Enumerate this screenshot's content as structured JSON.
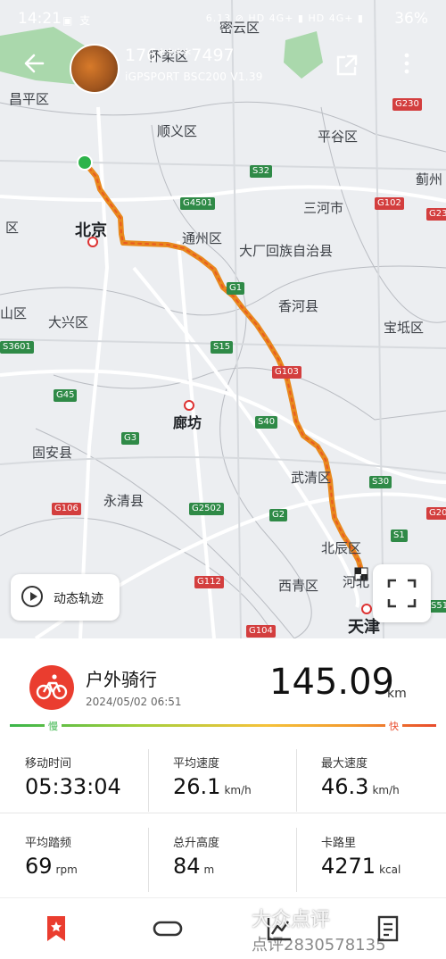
{
  "status_bar": {
    "time": "14:21",
    "icons_left": "▣ 支",
    "signal": "6.13 ⊘ HD 4G+ ▮ HD 4G+ ▮",
    "battery": "36%"
  },
  "header": {
    "device_title": "176****7497",
    "device_subtitle": "iGPSPORT BSC200 V1.39"
  },
  "map": {
    "places": {
      "miyun": "密云区",
      "huairou": "怀柔区",
      "changping": "昌平区",
      "shunyi": "顺义区",
      "pinggu": "平谷区",
      "jizhou": "蓟州",
      "beijing": "北京",
      "tongzhou": "通州区",
      "sanhe": "三河市",
      "dachang": "大厂回族自治县",
      "xianghe": "香河县",
      "baodi": "宝坻区",
      "daxing": "大兴区",
      "langfang": "廊坊",
      "guan": "固安县",
      "wuqing": "武清区",
      "yongqing": "永清县",
      "beichen": "北辰区",
      "xiqing": "西青区",
      "hexi": "河北",
      "tianjin": "天津",
      "edge_qu1": "区",
      "edge_shan": "山区"
    },
    "roads": [
      "G230",
      "S32",
      "G4501",
      "G102",
      "G23",
      "G1",
      "S15",
      "S3601",
      "G45",
      "G103",
      "G3",
      "S40",
      "S30",
      "G106",
      "G2502",
      "G2",
      "G20",
      "S1",
      "G112",
      "G104",
      "S51"
    ],
    "replay_label": "动态轨迹"
  },
  "activity": {
    "name": "户外骑行",
    "date": "2024/05/02 06:51",
    "distance": "145.09",
    "distance_unit": "km",
    "slow_label": "慢",
    "fast_label": "快"
  },
  "stats": [
    {
      "label": "移动时间",
      "value": "05:33:04",
      "unit": ""
    },
    {
      "label": "平均速度",
      "value": "26.1",
      "unit": "km/h"
    },
    {
      "label": "最大速度",
      "value": "46.3",
      "unit": "km/h"
    },
    {
      "label": "平均踏频",
      "value": "69",
      "unit": "rpm"
    },
    {
      "label": "总升高度",
      "value": "84",
      "unit": "m"
    },
    {
      "label": "卡路里",
      "value": "4271",
      "unit": "kcal"
    }
  ],
  "watermark": {
    "line1": "大众点评",
    "line2": "点评2830578135"
  },
  "colors": {
    "accent_red": "#ea3d2f",
    "route_orange": "#e8891e",
    "slow_green": "#3ab54a"
  }
}
